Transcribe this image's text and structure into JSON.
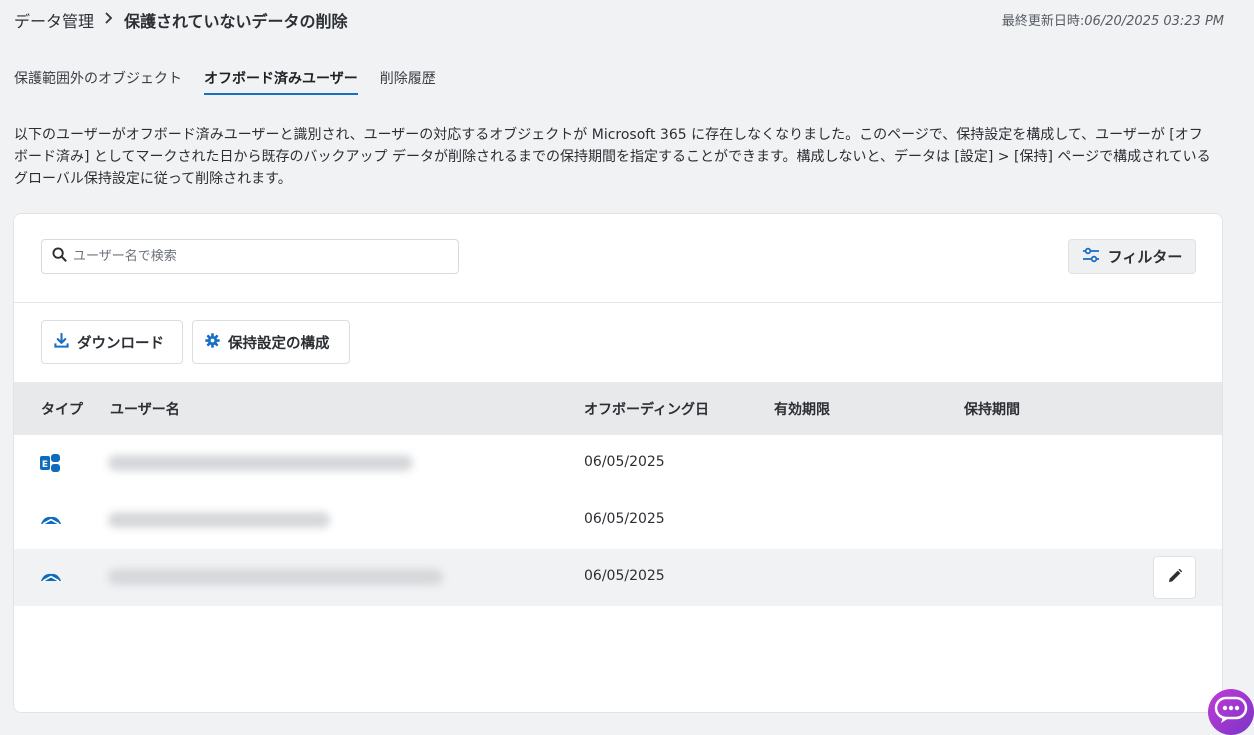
{
  "breadcrumb": {
    "parent": "データ管理",
    "separator": "›",
    "current": "保護されていないデータの削除"
  },
  "last_updated": {
    "label": "最終更新日時:",
    "value": "06/20/2025 03:23 PM"
  },
  "tabs": [
    {
      "label": "保護範囲外のオブジェクト",
      "active": false
    },
    {
      "label": "オフボード済みユーザー",
      "active": true
    },
    {
      "label": "削除履歴",
      "active": false
    }
  ],
  "description": "以下のユーザーがオフボード済みユーザーと識別され、ユーザーの対応するオブジェクトが Microsoft 365 に存在しなくなりました。このページで、保持設定を構成して、ユーザーが [オフボード済み] としてマークされた日から既存のバックアップ データが削除されるまでの保持期間を指定することができます。構成しないと、データは [設定] > [保持] ページで構成されているグローバル保持設定に従って削除されます。",
  "search": {
    "placeholder": "ユーザー名で検索",
    "value": ""
  },
  "filter_label": "フィルター",
  "actions": {
    "download": "ダウンロード",
    "configure_retention": "保持設定の構成"
  },
  "table": {
    "columns": [
      "タイプ",
      "ユーザー名",
      "オフボーディング日",
      "有効期限",
      "保持期間"
    ],
    "rows": [
      {
        "type_icon": "exchange-icon",
        "user": "",
        "offboarding_date": "06/05/2025",
        "expiry": "",
        "retention": "",
        "highlighted": false
      },
      {
        "type_icon": "onedrive-icon",
        "user": "",
        "offboarding_date": "06/05/2025",
        "expiry": "",
        "retention": "",
        "highlighted": false
      },
      {
        "type_icon": "onedrive-icon",
        "user": "",
        "offboarding_date": "06/05/2025",
        "expiry": "",
        "retention": "",
        "highlighted": true
      }
    ]
  },
  "colors": {
    "accent": "#1a6fc2",
    "icon_blue": "#0f6cbd",
    "chat_gradient": [
      "#c23ad6",
      "#7a35c8"
    ]
  }
}
